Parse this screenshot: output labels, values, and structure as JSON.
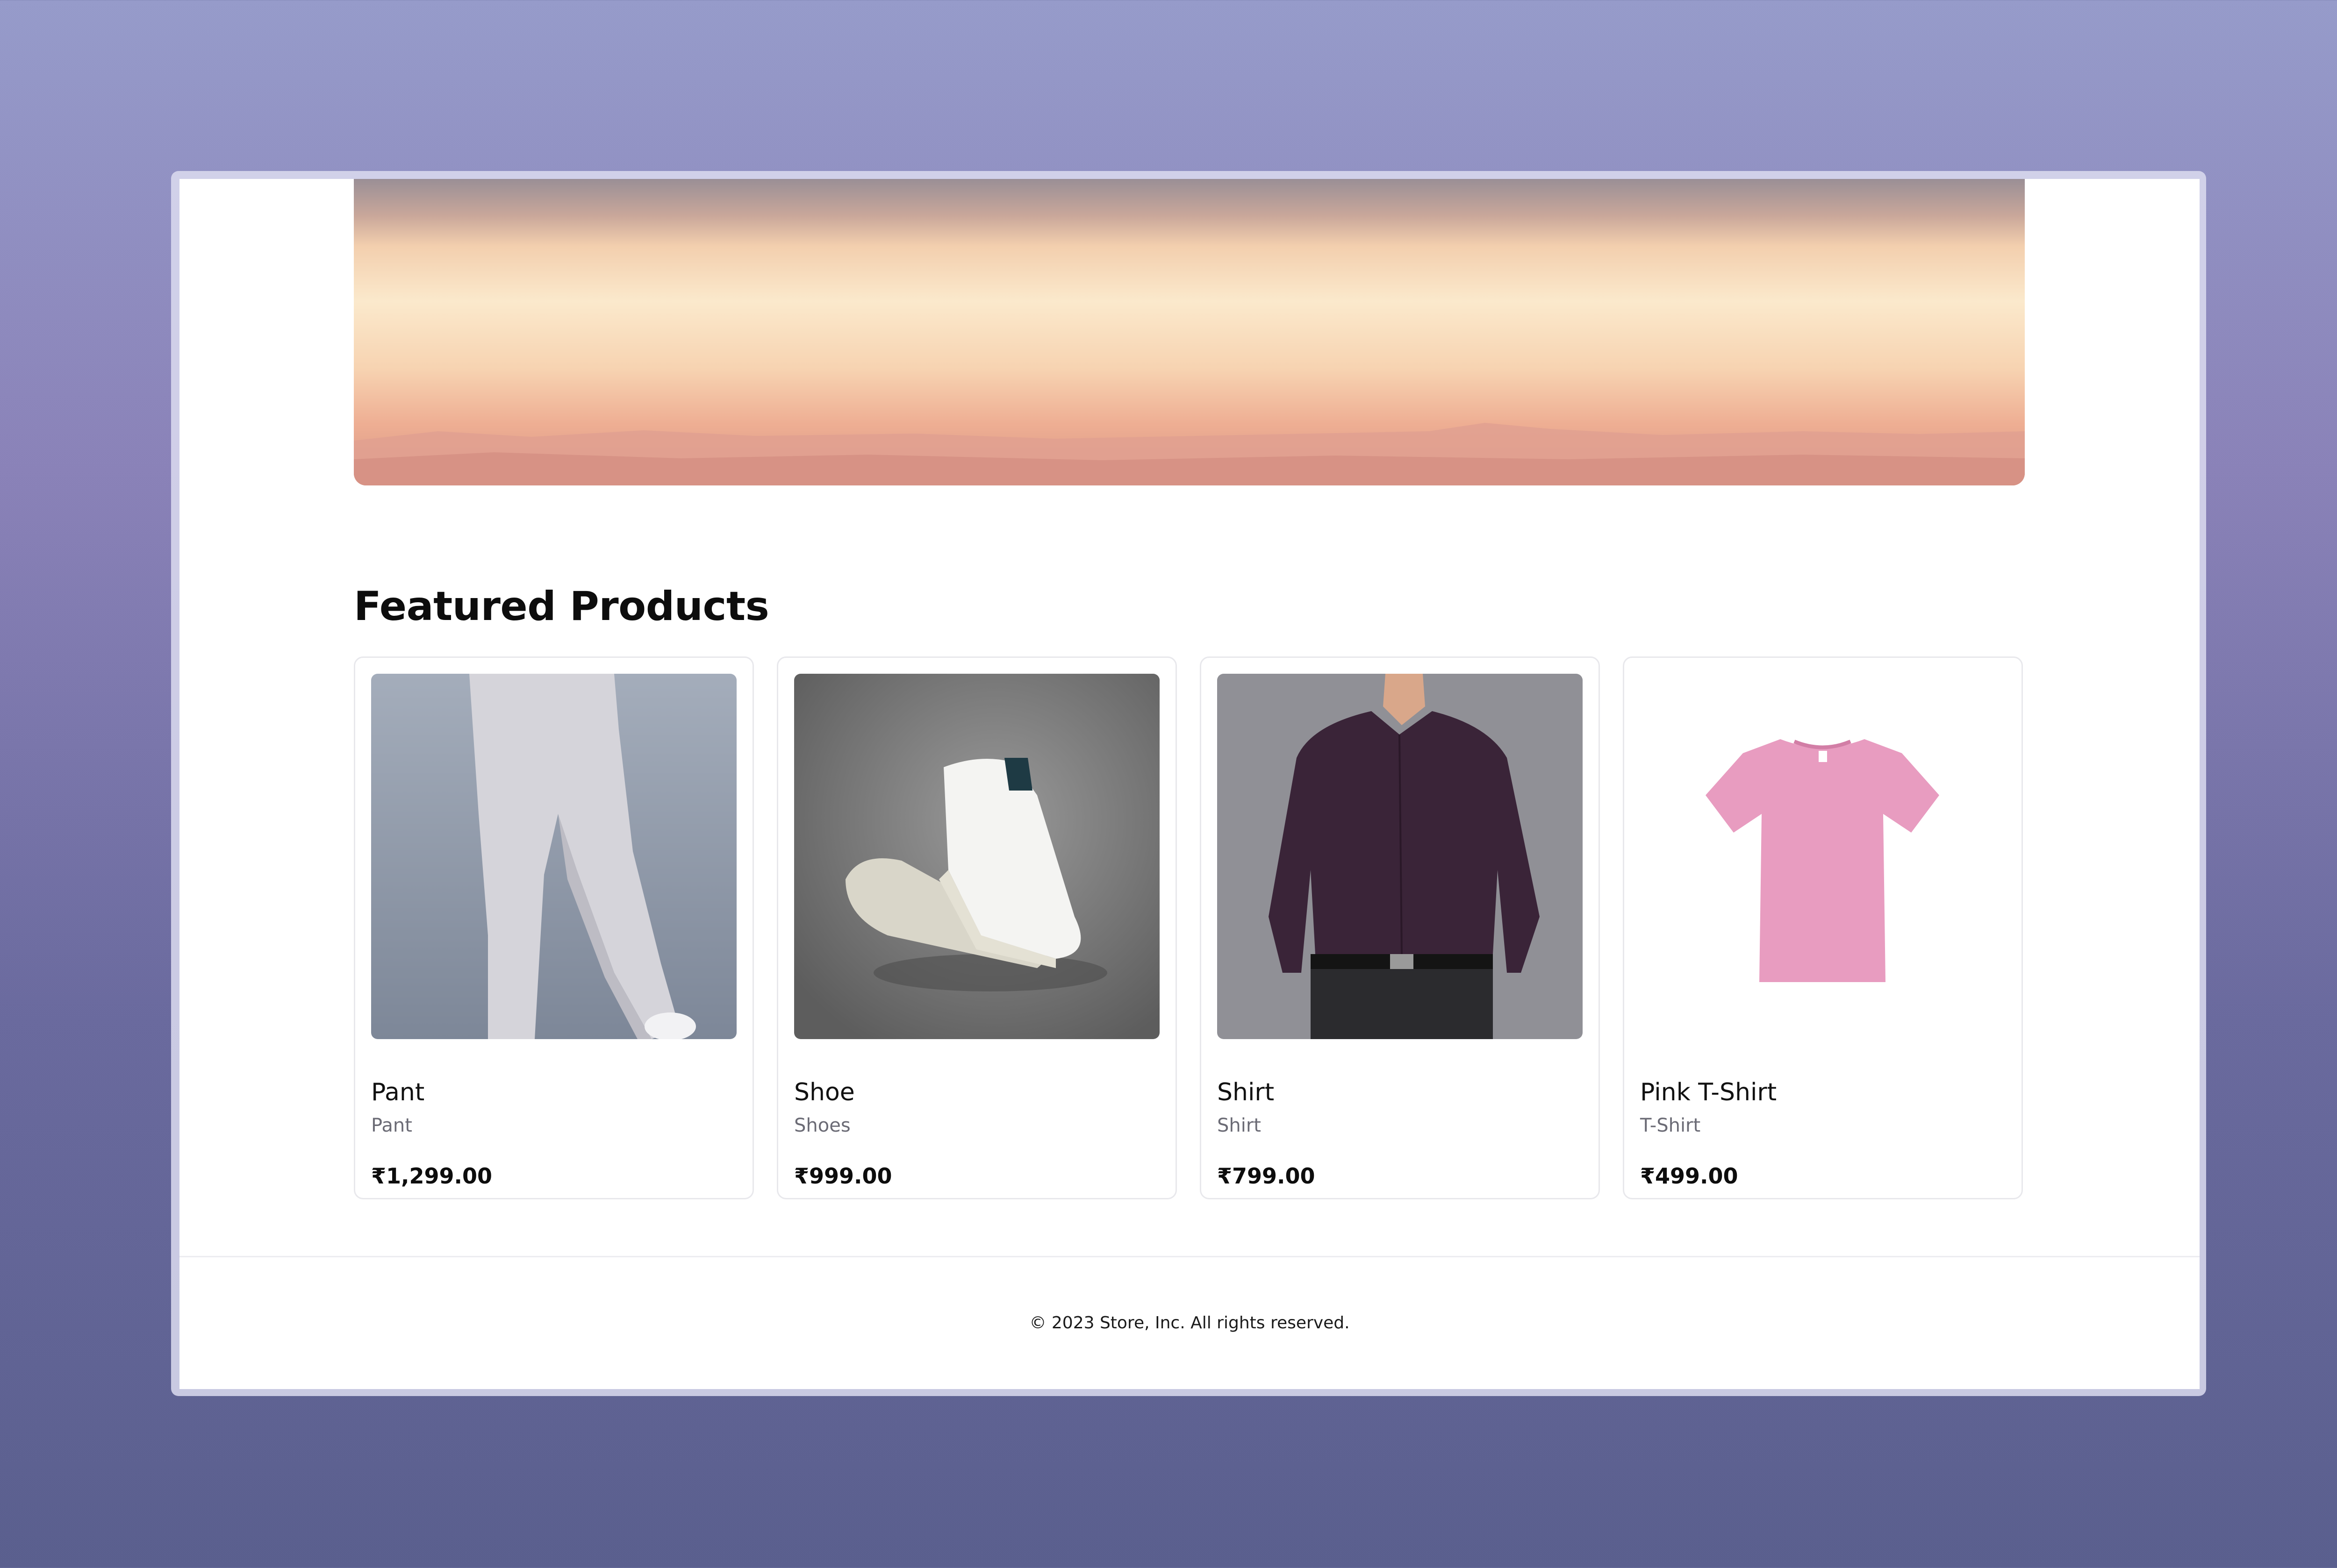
{
  "section": {
    "title": "Featured Products"
  },
  "products": [
    {
      "name": "Pant",
      "category": "Pant",
      "price": "₹1,299.00",
      "image_icon": "pant-photo"
    },
    {
      "name": "Shoe",
      "category": "Shoes",
      "price": "₹999.00",
      "image_icon": "shoe-photo"
    },
    {
      "name": "Shirt",
      "category": "Shirt",
      "price": "₹799.00",
      "image_icon": "shirt-photo"
    },
    {
      "name": "Pink T-Shirt",
      "category": "T-Shirt",
      "price": "₹499.00",
      "image_icon": "tshirt-photo"
    }
  ],
  "footer": {
    "copyright": "© 2023 Store, Inc. All rights reserved."
  },
  "colors": {
    "background_top": "#969bca",
    "background_bottom": "#5a5f8e",
    "tshirt": "#e89cc0",
    "shirt": "#3a2438"
  }
}
